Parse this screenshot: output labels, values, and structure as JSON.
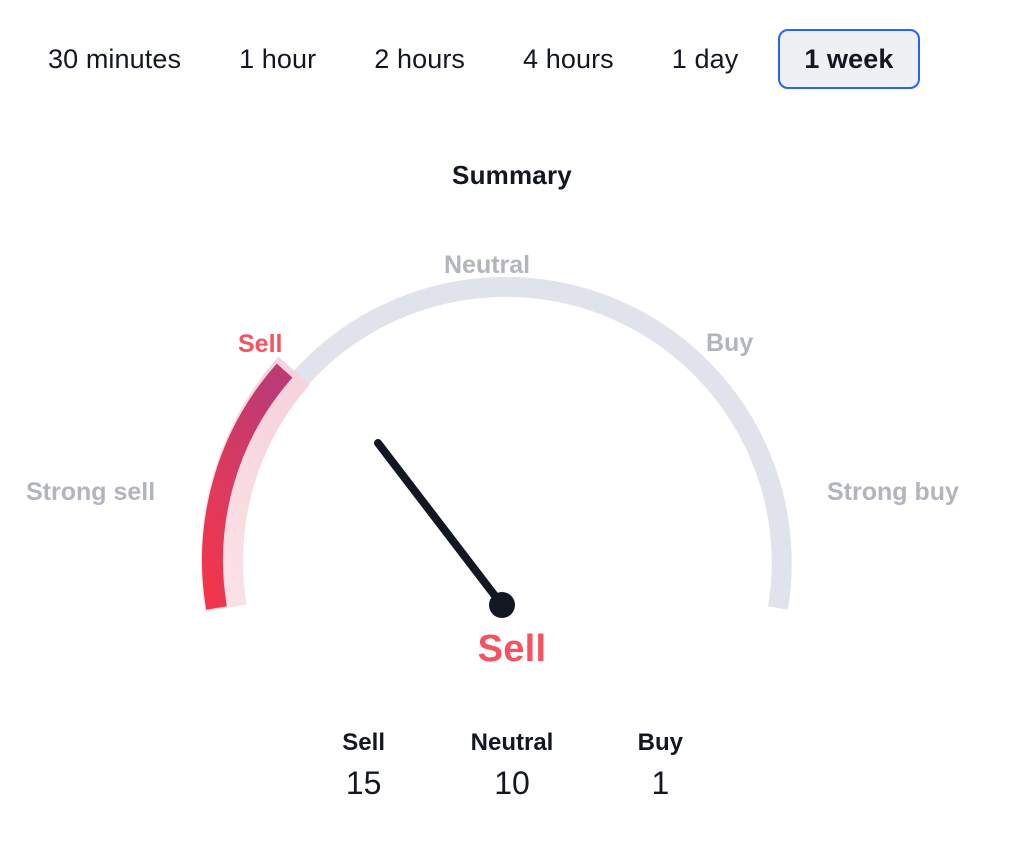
{
  "timeframes": {
    "items": [
      {
        "label": "30 minutes",
        "active": false
      },
      {
        "label": "1 hour",
        "active": false
      },
      {
        "label": "2 hours",
        "active": false
      },
      {
        "label": "4 hours",
        "active": false
      },
      {
        "label": "1 day",
        "active": false
      },
      {
        "label": "1 week",
        "active": true
      }
    ],
    "selected": "1 week"
  },
  "summary": {
    "title": "Summary",
    "verdict": "Sell"
  },
  "gauge": {
    "zones": [
      {
        "key": "strong_sell",
        "label": "Strong sell"
      },
      {
        "key": "sell",
        "label": "Sell"
      },
      {
        "key": "neutral",
        "label": "Neutral"
      },
      {
        "key": "buy",
        "label": "Buy"
      },
      {
        "key": "strong_buy",
        "label": "Strong buy"
      }
    ],
    "needle_zone": "Sell"
  },
  "counts": [
    {
      "label": "Sell",
      "value": "15"
    },
    {
      "label": "Neutral",
      "value": "10"
    },
    {
      "label": "Buy",
      "value": "1"
    }
  ],
  "chart_data": {
    "type": "gauge",
    "title": "Summary",
    "categories": [
      "Strong sell",
      "Sell",
      "Neutral",
      "Buy",
      "Strong buy"
    ],
    "verdict": "Sell",
    "series": [
      {
        "name": "Sell",
        "values": [
          15
        ]
      },
      {
        "name": "Neutral",
        "values": [
          10
        ]
      },
      {
        "name": "Buy",
        "values": [
          1
        ]
      }
    ],
    "values": [
      15,
      10,
      1
    ],
    "value_labels": [
      "Sell",
      "Neutral",
      "Buy"
    ],
    "needle_zone": "Sell",
    "needle_angle_deg": 232,
    "axis_range_deg": [
      180,
      360
    ],
    "grid": false,
    "legend": "none",
    "colors": {
      "sell_accent": "#f7525f",
      "arc_hot": "#f2354a",
      "arc_mid": "#dc3a5e",
      "arc_cool": "#bd3a74",
      "arc_soft": "#f7d8df",
      "arc_track": "#e0e3eb",
      "needle": "#131722",
      "text": "#131722",
      "muted_text": "#b2b5be",
      "tab_active_border": "#2962ff",
      "tab_active_fill": "#eef0f4"
    }
  }
}
